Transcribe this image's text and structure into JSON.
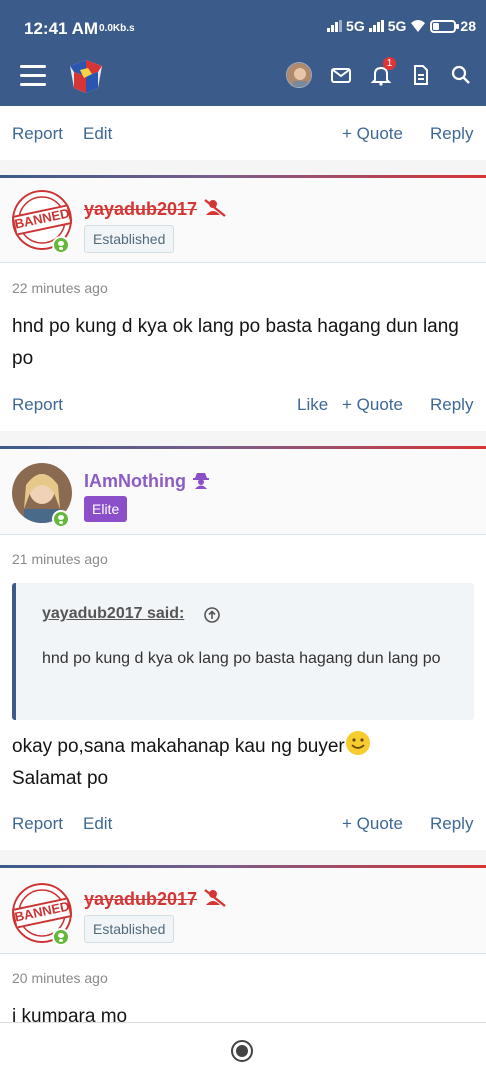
{
  "status": {
    "time": "12:41 AM",
    "speed": "0.0Kb.s",
    "net1": "5G",
    "net2": "5G",
    "battery": "28",
    "battery_level": 0.28
  },
  "appbar": {
    "notifications": "1",
    "icons": [
      "menu-icon",
      "site-logo",
      "avatar",
      "mail-icon",
      "bell-icon",
      "document-icon",
      "search-icon"
    ]
  },
  "colors": {
    "header": "#3b5b8a",
    "link": "#3e6896",
    "banned": "#d63535",
    "elite": "#8a4fc9",
    "online": "#66b83a"
  },
  "posts": [
    {
      "actions": {
        "report": "Report",
        "edit": "Edit",
        "quote": "+ Quote",
        "reply": "Reply"
      }
    },
    {
      "user": "yayadub2017",
      "role": "Established",
      "avatar_stamp": "BANNED",
      "time": "22 minutes ago",
      "text": "hnd po kung d kya ok lang po basta hagang dun lang po",
      "actions": {
        "report": "Report",
        "like": "Like",
        "quote": "+ Quote",
        "reply": "Reply"
      }
    },
    {
      "user": "IAmNothing",
      "role": "Elite",
      "time": "21 minutes ago",
      "quote_head": "yayadub2017 said:",
      "quote_text": "hnd po kung d kya ok lang po basta hagang dun lang po",
      "text_line1": "okay po,sana makahanap kau ng buyer",
      "text_line2": "Salamat po",
      "actions": {
        "report": "Report",
        "edit": "Edit",
        "quote": "+ Quote",
        "reply": "Reply"
      }
    },
    {
      "user": "yayadub2017",
      "role": "Established",
      "avatar_stamp": "BANNED",
      "time": "20 minutes ago",
      "text": "i kumpara mo"
    }
  ]
}
